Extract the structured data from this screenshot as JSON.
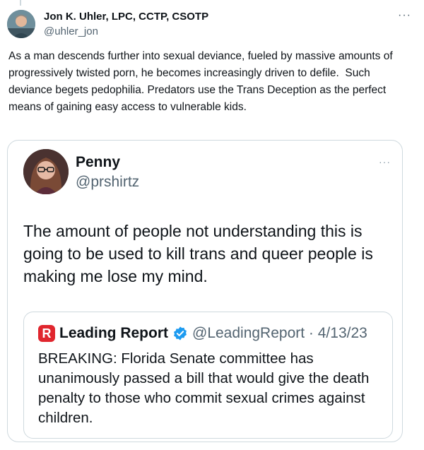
{
  "tweet": {
    "author_name": "Jon K. Uhler, LPC, CCTP, CSOTP",
    "author_handle": "@uhler_jon",
    "more_label": "···",
    "text": "As a man descends further into sexual deviance, fueled by massive amounts of progressively twisted porn, he becomes increasingly driven to defile.  Such deviance begets pedophilia. Predators use the Trans Deception as the perfect means of gaining easy access to vulnerable kids."
  },
  "quoted": {
    "name": "Penny",
    "handle": "@prshirtz",
    "more_label": "···",
    "text": "The amount of people not understanding this is going to be used to kill trans and queer people is making me lose my mind."
  },
  "inner_quote": {
    "logo_letter": "R",
    "name": "Leading Report",
    "handle_date": "@LeadingReport · 4/13/23",
    "text": "BREAKING: Florida Senate committee has unanimously passed a bill that would give the death penalty to those who commit sexual crimes against children.",
    "verified_color": "#1d9bf0",
    "logo_color": "#e0262e"
  },
  "icons": {
    "main_avatar": "avatar-photo",
    "quoted_avatar": "avatar-photo",
    "verified": "verified-badge-icon",
    "more": "more-options-icon"
  }
}
